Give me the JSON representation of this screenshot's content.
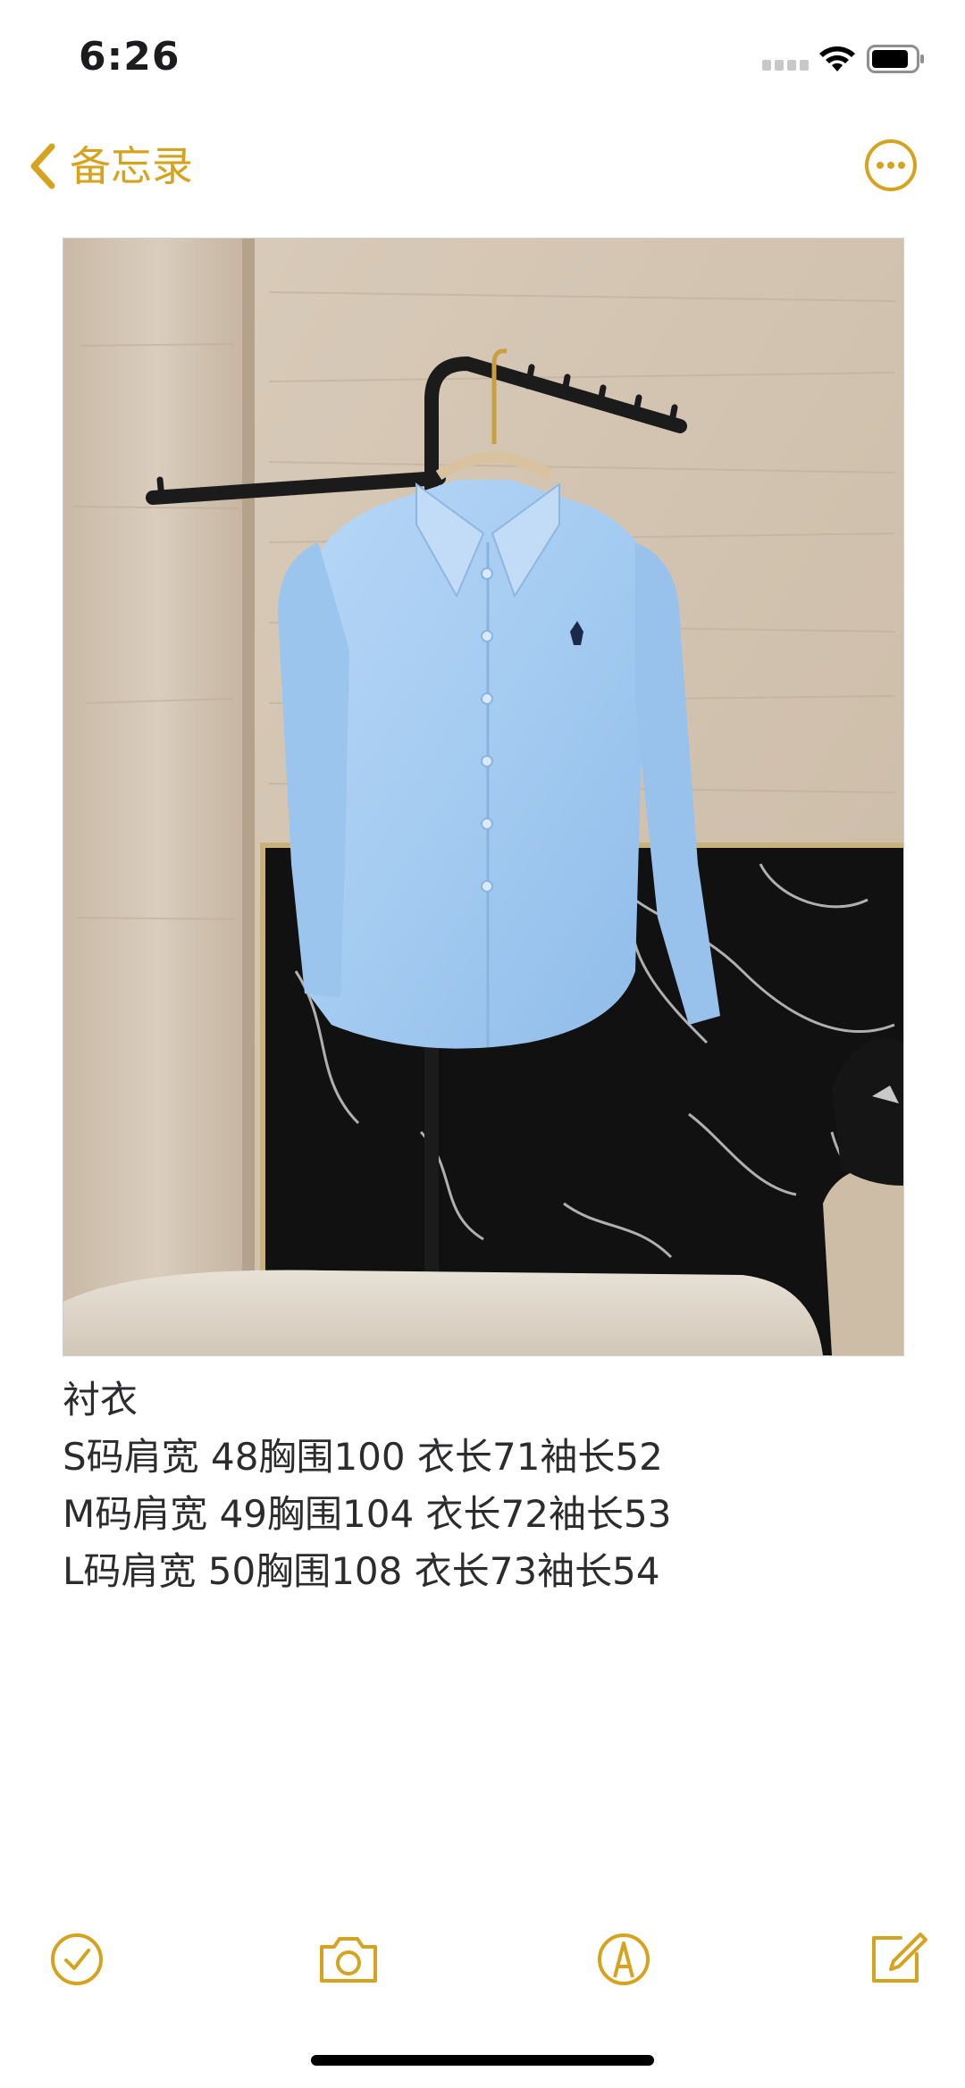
{
  "status_bar": {
    "time": "6:26"
  },
  "nav_bar": {
    "back_label": "备忘录"
  },
  "note": {
    "lines": [
      "衬衣",
      "S码肩宽 48胸围100 衣长71袖长52",
      "M码肩宽 49胸围104 衣长72袖长53",
      "L码肩宽 50胸围108 衣长73袖长54"
    ]
  },
  "icons": {
    "back": "chevron-left-icon",
    "more": "ellipsis-circle-icon",
    "checklist": "checkmark-circle-icon",
    "camera": "camera-icon",
    "markup": "pen-tip-circle-icon",
    "compose": "square-and-pencil-icon"
  },
  "colors": {
    "accent": "#d6a31e",
    "background": "#ffffff",
    "text": "#2c2c2e",
    "shirt": "#a9cdf2"
  }
}
